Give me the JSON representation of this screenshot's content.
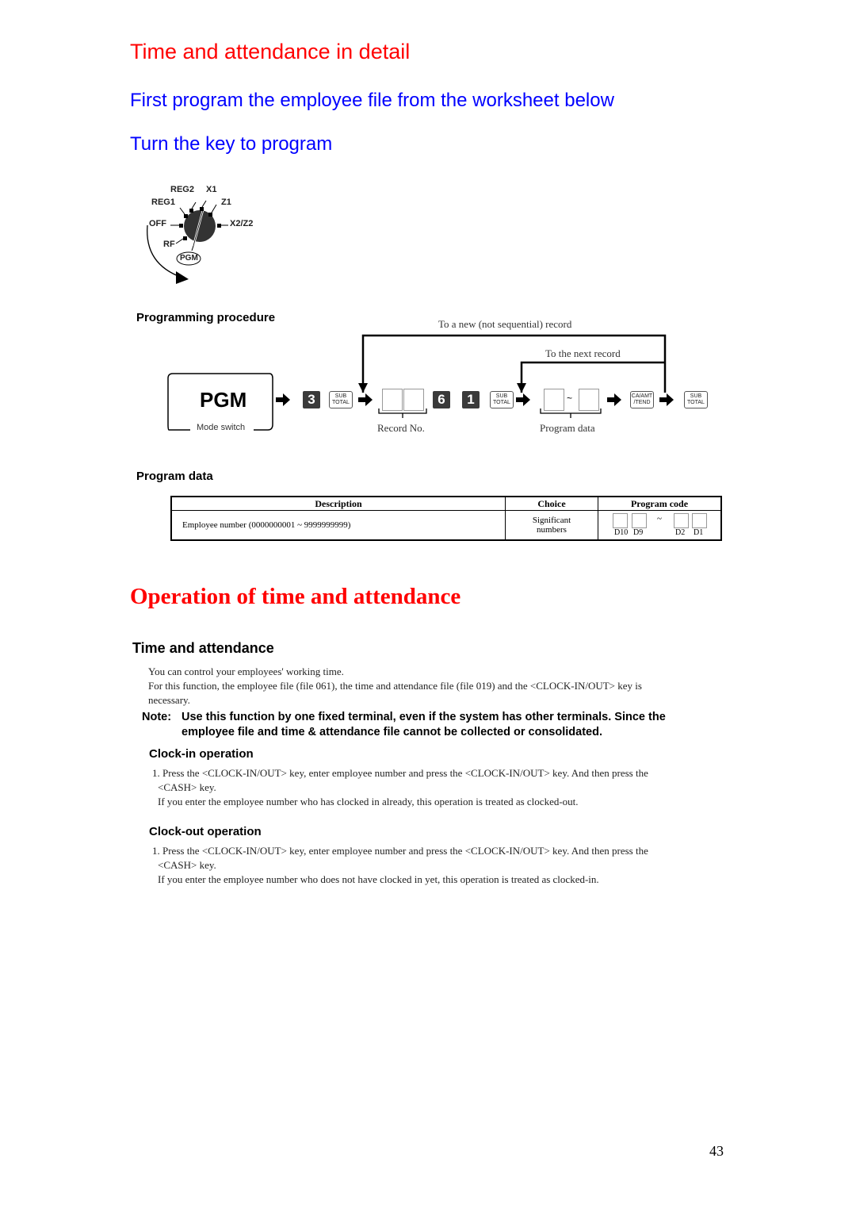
{
  "headings": {
    "main_title": "Time and attendance in detail",
    "subtitle_1": "First program the employee file from the worksheet below",
    "subtitle_2": "Turn the key to program",
    "section_2_title": "Operation of time and attendance"
  },
  "mode_switch": {
    "positions": [
      "REG2",
      "X1",
      "REG1",
      "Z1",
      "OFF",
      "X2/Z2",
      "RF",
      "PGM"
    ],
    "labels": {
      "reg2": "REG2",
      "x1": "X1",
      "reg1": "REG1",
      "z1": "Z1",
      "off": "OFF",
      "x2z2": "X2/Z2",
      "rf": "RF",
      "pgm": "PGM"
    }
  },
  "programming_procedure": {
    "title": "Programming procedure",
    "mode_key": "PGM",
    "mode_caption": "Mode switch",
    "key_3": "3",
    "key_6": "6",
    "key_1": "1",
    "subtotal_label_top": "SUB",
    "subtotal_label_bottom": "TOTAL",
    "ca_label_top": "CA/AMT",
    "ca_label_bottom": "/TEND",
    "tilde": "~",
    "record_no_label": "Record No.",
    "program_data_label": "Program data",
    "loop_new_record": "To a new (not sequential) record",
    "loop_next_record": "To the next record"
  },
  "program_data": {
    "title": "Program data",
    "headers": [
      "Description",
      "Choice",
      "Program code"
    ],
    "rows": [
      {
        "description": "Employee number (0000000001 ~ 9999999999)",
        "choice_line1": "Significant",
        "choice_line2": "numbers",
        "code_digits": [
          "D10",
          "D9",
          "D2",
          "D1"
        ],
        "code_tilde": "~"
      }
    ]
  },
  "time_attendance": {
    "title": "Time and attendance",
    "intro_1": "You can control your employees' working time.",
    "intro_2": "For this function, the employee file (file 061), the time and attendance file (file 019) and the <CLOCK-IN/OUT> key is",
    "intro_3": "necessary.",
    "note_label": "Note:",
    "note_line1": "Use this function by one fixed terminal, even if the system has other terminals. Since the",
    "note_line2": "employee file and time & attendance file cannot be collected or consolidated.",
    "clock_in": {
      "title": "Clock-in operation",
      "step_1a": "1. Press the <CLOCK-IN/OUT> key, enter employee number and press the <CLOCK-IN/OUT> key. And then press the",
      "step_1b": "<CASH> key.",
      "step_1c": "If you enter the employee number who has clocked in already, this operation is treated as clocked-out."
    },
    "clock_out": {
      "title": "Clock-out operation",
      "step_1a": "1. Press the <CLOCK-IN/OUT> key, enter employee number and press the <CLOCK-IN/OUT> key. And then press the",
      "step_1b": "<CASH> key.",
      "step_1c": "If you enter the employee number who does not have clocked in yet, this operation is treated as clocked-in."
    }
  },
  "footer": {
    "page_number": "43"
  }
}
